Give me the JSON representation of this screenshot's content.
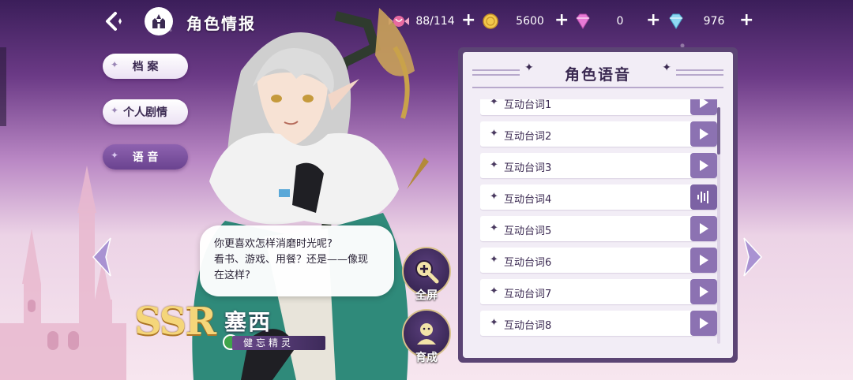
{
  "header": {
    "title": "角色情报",
    "back_icon": "back-arrow-icon",
    "home_icon": "castle-icon"
  },
  "resources": [
    {
      "icon": "candy-icon",
      "value": "88/114"
    },
    {
      "icon": "gold-coin-icon",
      "value": "5600"
    },
    {
      "icon": "pink-diamond-icon",
      "value": "0"
    },
    {
      "icon": "blue-diamond-icon",
      "value": "976"
    }
  ],
  "menu": {
    "items": [
      {
        "label": "档 案",
        "active": false
      },
      {
        "label": "个人剧情",
        "active": false
      },
      {
        "label": "语 音",
        "active": true
      }
    ]
  },
  "dialogue": {
    "line1": "你更喜欢怎样消磨时光呢?",
    "line2": "看书、游戏、用餐？还是——像现",
    "line3": "在这样?"
  },
  "actions": {
    "fullscreen_label": "全屏",
    "develop_label": "育成"
  },
  "character": {
    "rarity": "SSR",
    "name": "塞西",
    "title": "健忘精灵",
    "element_color": "#3fa44b"
  },
  "voice_panel": {
    "title": "角色语音",
    "items": [
      {
        "label": "互动台词1",
        "state": "play"
      },
      {
        "label": "互动台词2",
        "state": "play"
      },
      {
        "label": "互动台词3",
        "state": "play"
      },
      {
        "label": "互动台词4",
        "state": "playing"
      },
      {
        "label": "互动台词5",
        "state": "play"
      },
      {
        "label": "互动台词6",
        "state": "play"
      },
      {
        "label": "互动台词7",
        "state": "play"
      },
      {
        "label": "互动台词8",
        "state": "play"
      }
    ]
  },
  "colors": {
    "accent": "#8c72b2",
    "panel_frame": "#5b4474",
    "gold": "#f5d67a"
  }
}
